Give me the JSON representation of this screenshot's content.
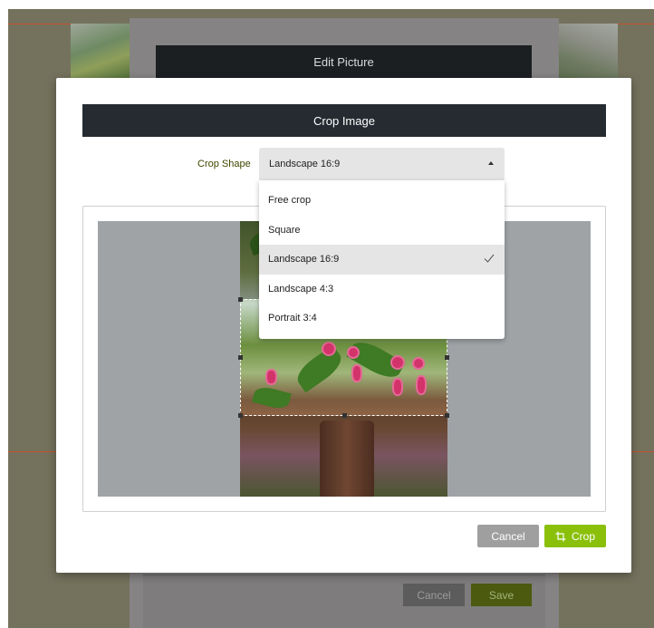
{
  "edit_dialog": {
    "title": "Edit Picture",
    "cancel_label": "Cancel",
    "save_label": "Save"
  },
  "crop_dialog": {
    "title": "Crop Image",
    "crop_shape_label": "Crop Shape",
    "crop_shape_value": "Landscape 16:9",
    "cancel_label": "Cancel",
    "crop_label": "Crop",
    "crop_icon": "crop-icon"
  },
  "dropdown": {
    "options": [
      {
        "label": "Free crop",
        "selected": false
      },
      {
        "label": "Square",
        "selected": false
      },
      {
        "label": "Landscape 16:9",
        "selected": true
      },
      {
        "label": "Landscape 4:3",
        "selected": false
      },
      {
        "label": "Portrait 3:4",
        "selected": false
      }
    ],
    "check_icon": "checkmark-icon"
  },
  "colors": {
    "accent": "#8ac00a",
    "header_dark": "#252b31",
    "label_color": "#404700"
  }
}
